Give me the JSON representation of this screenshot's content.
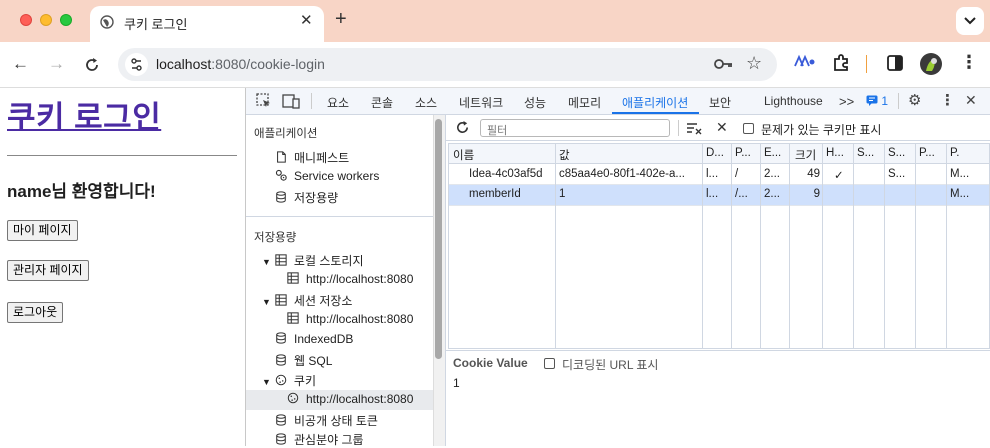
{
  "browser": {
    "tab_title": "쿠키 로그인",
    "url_host": "localhost",
    "url_rest": ":8080/cookie-login"
  },
  "page": {
    "heading": "쿠키 로그인",
    "welcome": "name님 환영합니다!",
    "buttons": [
      "마이 페이지",
      "관리자 페이지",
      "로그아웃"
    ]
  },
  "devtools": {
    "tabs": [
      "요소",
      "콘솔",
      "소스",
      "네트워크",
      "성능",
      "메모리",
      "애플리케이션",
      "보안",
      "Lighthouse"
    ],
    "more_tabs": ">>",
    "issues_count": "1",
    "active_tab": "애플리케이션",
    "sidebar": {
      "app_section": "애플리케이션",
      "app_items": [
        "매니페스트",
        "Service workers",
        "저장용량"
      ],
      "storage_section": "저장용량",
      "storage_items": [
        {
          "label": "로컬 스토리지",
          "child": "http://localhost:8080"
        },
        {
          "label": "세션 저장소",
          "child": "http://localhost:8080"
        }
      ],
      "indexeddb": "IndexedDB",
      "websql": "웹 SQL",
      "cookies": "쿠키",
      "cookies_child": "http://localhost:8080",
      "private_state": "비공개 상태 토큰",
      "interest_groups": "관심분야 그룹"
    },
    "filter_placeholder": "필터",
    "only_issues_label": "문제가 있는 쿠키만 표시",
    "columns": [
      "이름",
      "값",
      "D...",
      "P...",
      "E...",
      "크기",
      "H...",
      "S...",
      "S...",
      "P...",
      "P."
    ],
    "rows": [
      [
        "Idea-4c03af5d",
        "c85aa4e0-80f1-402e-a...",
        "l...",
        "/",
        "2...",
        "49",
        "✓",
        "",
        "S...",
        "",
        "M..."
      ],
      [
        "memberId",
        "1",
        "l...",
        "/...",
        "2...",
        "9",
        "",
        "",
        "",
        "",
        "M..."
      ]
    ],
    "selected_row": 1,
    "cookie_value_title": "Cookie Value",
    "decoded_url_label": "디코딩된 URL 표시",
    "cookie_value": "1"
  }
}
